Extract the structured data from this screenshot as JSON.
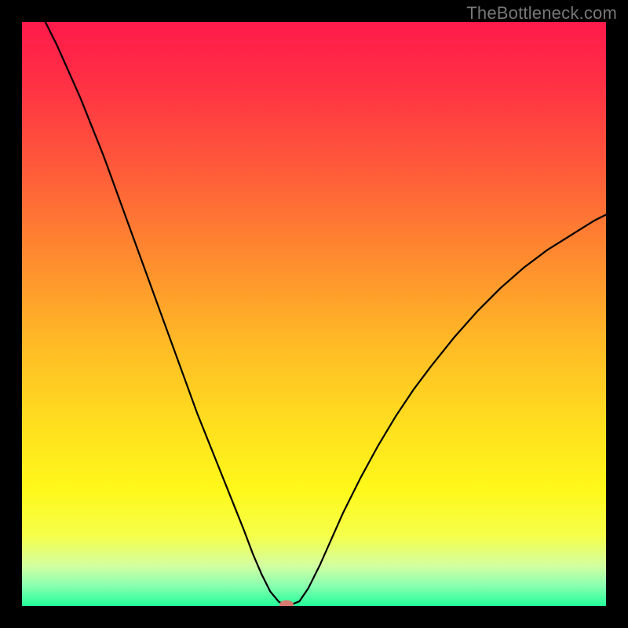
{
  "watermark": "TheBottleneck.com",
  "colors": {
    "curve": "#000000",
    "marker": "#d77a6f",
    "page_bg": "#000000"
  },
  "gradient_stops": [
    {
      "offset": 0.0,
      "color": "#ff1a4b"
    },
    {
      "offset": 0.1,
      "color": "#ff2f45"
    },
    {
      "offset": 0.25,
      "color": "#ff5a3a"
    },
    {
      "offset": 0.4,
      "color": "#ff8a2f"
    },
    {
      "offset": 0.55,
      "color": "#ffba26"
    },
    {
      "offset": 0.7,
      "color": "#ffe11e"
    },
    {
      "offset": 0.8,
      "color": "#fff81a"
    },
    {
      "offset": 0.88,
      "color": "#f5ff4a"
    },
    {
      "offset": 0.93,
      "color": "#d4ffa0"
    },
    {
      "offset": 0.965,
      "color": "#8affb0"
    },
    {
      "offset": 1.0,
      "color": "#22ff99"
    }
  ],
  "chart_data": {
    "type": "line",
    "title": "",
    "xlabel": "",
    "ylabel": "",
    "xlim": [
      0,
      100
    ],
    "ylim": [
      0,
      100
    ],
    "grid": false,
    "legend": false,
    "annotations": [],
    "x": [
      4.0,
      6.0,
      8.0,
      10.0,
      12.0,
      14.0,
      16.0,
      18.0,
      20.0,
      22.0,
      24.0,
      26.0,
      28.0,
      30.0,
      32.0,
      34.0,
      36.0,
      38.0,
      39.5,
      41.0,
      42.5,
      44.0,
      45.0,
      46.0,
      47.5,
      49.0,
      51.0,
      53.0,
      55.0,
      58.0,
      61.0,
      64.0,
      67.0,
      70.0,
      74.0,
      78.0,
      82.0,
      86.0,
      90.0,
      94.0,
      98.0,
      100.0
    ],
    "values": [
      100.0,
      96.0,
      91.5,
      87.0,
      82.0,
      77.0,
      71.5,
      66.0,
      60.5,
      55.0,
      49.5,
      44.0,
      38.5,
      33.0,
      28.0,
      23.0,
      18.0,
      13.0,
      9.0,
      5.5,
      2.5,
      0.7,
      0.2,
      0.2,
      0.8,
      3.0,
      7.0,
      11.5,
      16.0,
      22.0,
      27.5,
      32.5,
      37.0,
      41.0,
      46.0,
      50.5,
      54.5,
      58.0,
      61.0,
      63.5,
      66.0,
      67.0
    ],
    "marker": {
      "x": 45.3,
      "y": 0.2
    }
  }
}
